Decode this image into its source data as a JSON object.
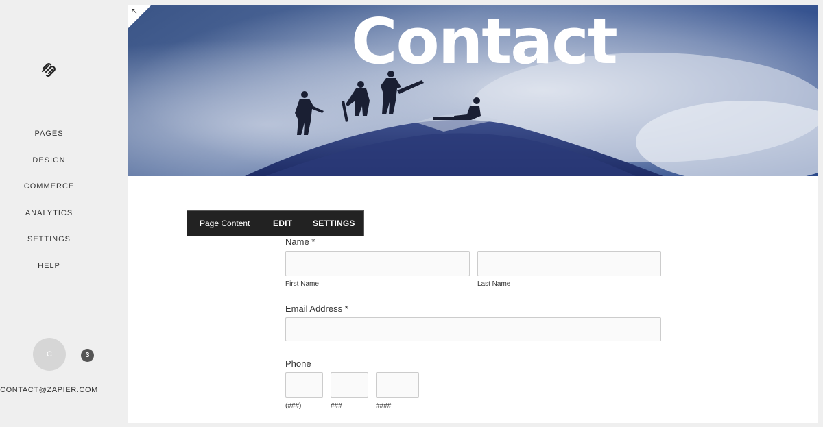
{
  "sidebar": {
    "logo_icon": "squarespace-logo-icon",
    "nav": [
      {
        "label": "PAGES"
      },
      {
        "label": "DESIGN"
      },
      {
        "label": "COMMERCE"
      },
      {
        "label": "ANALYTICS"
      },
      {
        "label": "SETTINGS"
      },
      {
        "label": "HELP"
      }
    ],
    "avatar_initial": "C",
    "notification_count": "3",
    "account_email": "CONTACT@ZAPIER.COM"
  },
  "banner": {
    "title": "Contact",
    "expand_icon": "↖"
  },
  "toolbar": {
    "label": "Page Content",
    "edit": "EDIT",
    "settings": "SETTINGS"
  },
  "form": {
    "name": {
      "label": "Name *",
      "first_label": "First Name",
      "last_label": "Last Name",
      "first_value": "",
      "last_value": ""
    },
    "email": {
      "label": "Email Address *",
      "value": ""
    },
    "phone": {
      "label": "Phone",
      "part1_label": "(###)",
      "part2_label": "###",
      "part3_label": "####"
    }
  }
}
